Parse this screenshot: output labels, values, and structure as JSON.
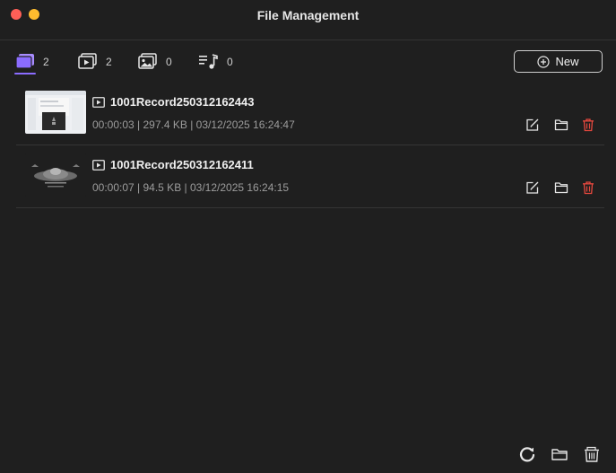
{
  "window": {
    "title": "File Management"
  },
  "tabs": [
    {
      "name": "all",
      "icon": "all-files-icon",
      "count": "2"
    },
    {
      "name": "video",
      "icon": "video-icon",
      "count": "2"
    },
    {
      "name": "image",
      "icon": "image-icon",
      "count": "0"
    },
    {
      "name": "audio",
      "icon": "audio-icon",
      "count": "0"
    }
  ],
  "toolbar": {
    "new_label": "New"
  },
  "files": [
    {
      "name": "1001Record250312162443",
      "meta": "00:00:03 | 297.4 KB | 03/12/2025 16:24:47"
    },
    {
      "name": "1001Record250312162411",
      "meta": "00:00:07 | 94.5 KB | 03/12/2025 16:24:15"
    }
  ],
  "colors": {
    "accent": "#8b6cff",
    "delete": "#e5483e",
    "background": "#1f1f1f"
  }
}
